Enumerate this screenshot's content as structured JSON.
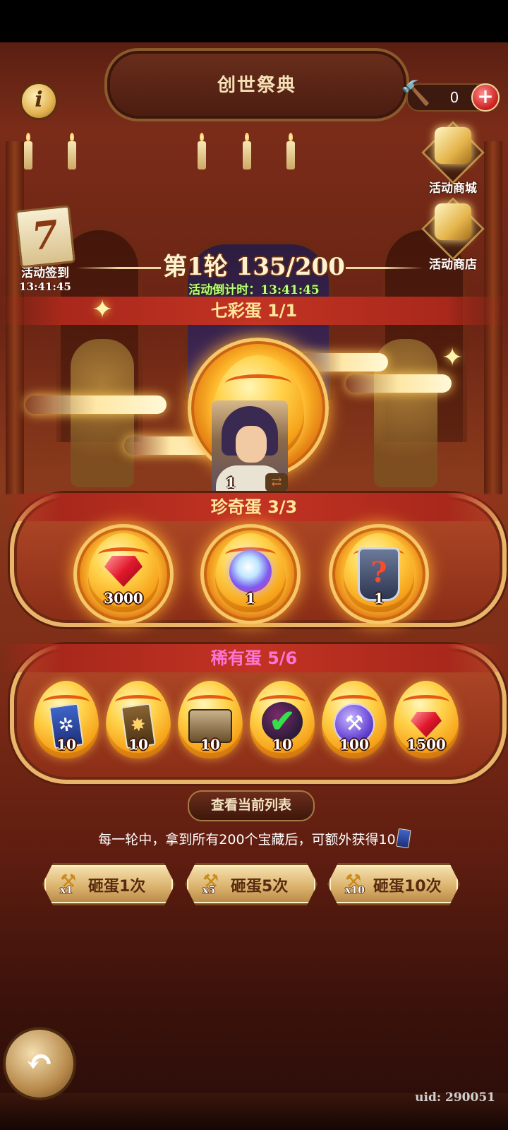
{
  "header": {
    "title": "创世祭典"
  },
  "hammer": {
    "count": "0"
  },
  "side_buttons": {
    "mall_label": "活动商城",
    "shop_label": "活动商店",
    "signin_label": "活动签到",
    "signin_time": "13:41:45",
    "signin_day": "7"
  },
  "round": {
    "text": "第1轮 135/200",
    "countdown": "活动倒计时：13:41:45"
  },
  "tiers": {
    "rainbow": {
      "title": "七彩蛋 1/1",
      "item_count": "1"
    },
    "rare_treasure": {
      "title": "珍奇蛋 3/3",
      "items": [
        {
          "icon": "ruby-gem-icon",
          "count": "3000"
        },
        {
          "icon": "magic-orb-icon",
          "count": "1"
        },
        {
          "icon": "mystery-armor-icon",
          "count": "1"
        }
      ]
    },
    "rare": {
      "title": "稀有蛋 5/6",
      "items": [
        {
          "icon": "blue-card-icon",
          "count": "10"
        },
        {
          "icon": "brown-card-icon",
          "count": "10"
        },
        {
          "icon": "treasure-chest-icon",
          "count": "10"
        },
        {
          "icon": "checked-bag-icon",
          "count": "10"
        },
        {
          "icon": "purple-hammer-coin-icon",
          "count": "100"
        },
        {
          "icon": "ruby-gem-icon",
          "count": "1500"
        }
      ]
    }
  },
  "view_list_label": "查看当前列表",
  "description": "每一轮中，拿到所有200个宝藏后，可额外获得10",
  "smash_buttons": [
    {
      "mult": "x1",
      "label": "砸蛋1次"
    },
    {
      "mult": "x5",
      "label": "砸蛋5次"
    },
    {
      "mult": "x10",
      "label": "砸蛋10次"
    }
  ],
  "uid": "uid: 290051",
  "colors": {
    "gold": "#ffe69a",
    "pink": "#ff74d6",
    "countdown_green": "#b6ff7a"
  }
}
